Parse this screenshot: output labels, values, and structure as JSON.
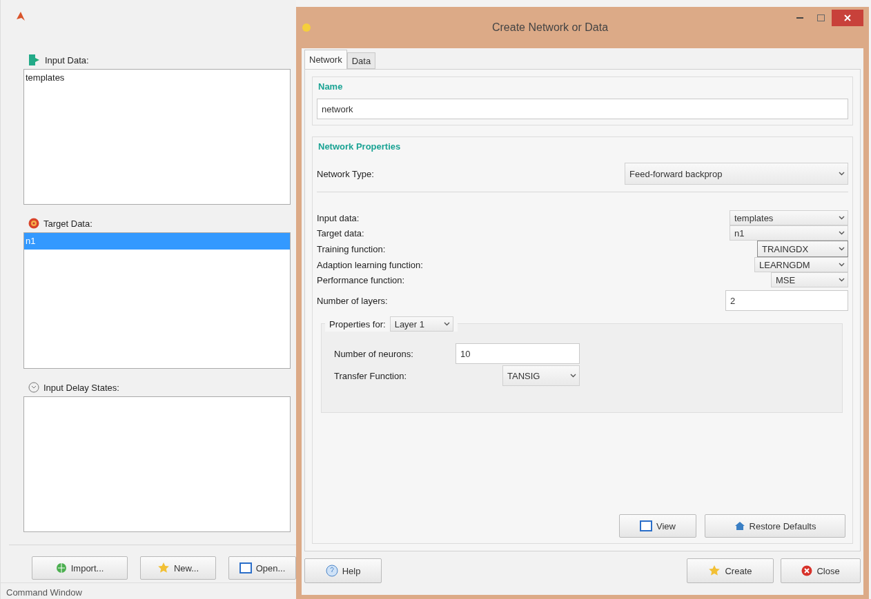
{
  "left_panel": {
    "lists": [
      {
        "kind": "input",
        "label": "Input Data:",
        "items": [
          {
            "text": "templates",
            "selected": false
          }
        ]
      },
      {
        "kind": "target",
        "label": "Target Data:",
        "items": [
          {
            "text": "n1",
            "selected": true
          }
        ]
      },
      {
        "kind": "delay",
        "label": "Input Delay States:"
      }
    ],
    "buttons": [
      {
        "kind": "import",
        "label": "Import..."
      },
      {
        "kind": "new",
        "label": "New..."
      },
      {
        "kind": "open",
        "label": "Open..."
      }
    ],
    "command_window": "Command Window"
  },
  "dialog": {
    "title": "Create Network or Data",
    "tabs": [
      {
        "label": "Network",
        "selected": true
      },
      {
        "label": "Data",
        "selected": false
      }
    ],
    "name_group": {
      "title": "Name",
      "value": "network"
    },
    "properties": {
      "title": "Network Properties",
      "network_type": {
        "label": "Network Type:",
        "value": "Feed-forward backprop"
      },
      "fields": [
        {
          "kind": "dropdown",
          "label": "Input data:",
          "value": "templates",
          "focused": false
        },
        {
          "kind": "dropdown",
          "label": "Target data:",
          "value": "n1",
          "focused": false
        },
        {
          "kind": "dropdown",
          "label": "Training function:",
          "value": "TRAINGDX",
          "focused": true
        },
        {
          "kind": "dropdown",
          "label": "Adaption learning function:",
          "value": "LEARNGDM",
          "focused": false
        },
        {
          "kind": "dropdown",
          "label": "Performance function:",
          "value": "MSE",
          "focused": false
        },
        {
          "kind": "text",
          "label": "Number of layers:",
          "value": "2"
        }
      ],
      "layer": {
        "label": "Properties for:",
        "value": "Layer 1",
        "fields": [
          {
            "kind": "text",
            "label": "Number of neurons:",
            "value": "10"
          },
          {
            "kind": "dropdown",
            "label": "Transfer Function:",
            "value": "TANSIG"
          }
        ]
      }
    },
    "actions": [
      {
        "kind": "view",
        "label": "View"
      },
      {
        "kind": "restore",
        "label": "Restore Defaults"
      }
    ],
    "footer": [
      {
        "kind": "help",
        "label": "Help"
      },
      {
        "kind": "create",
        "label": "Create"
      },
      {
        "kind": "close",
        "label": "Close"
      }
    ]
  }
}
